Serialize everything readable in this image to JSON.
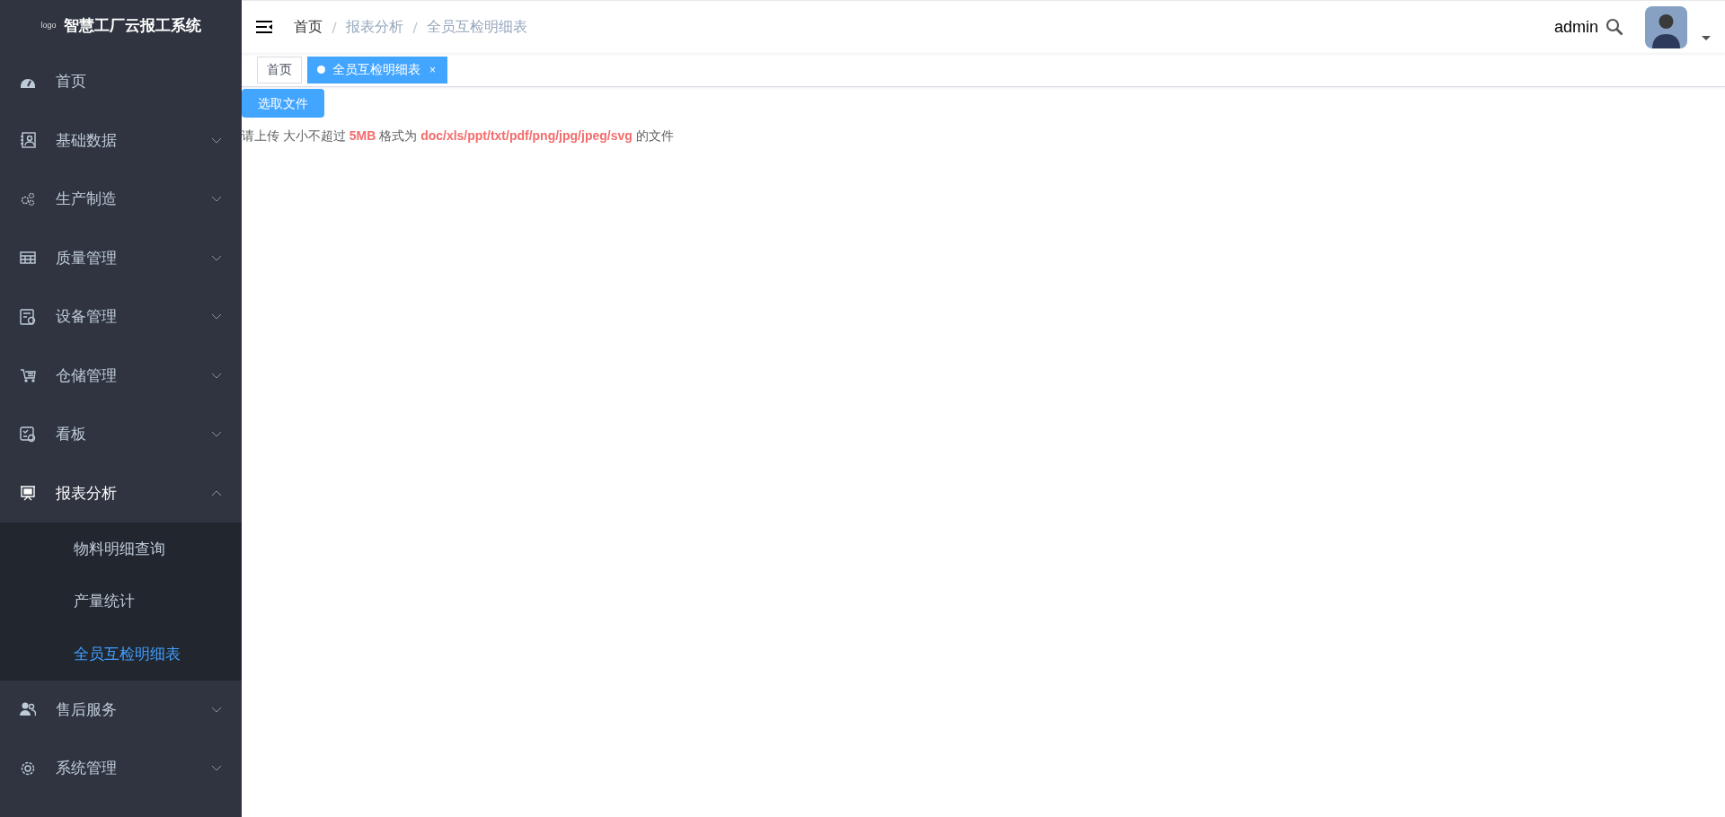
{
  "sidebar": {
    "logo_text": "logo",
    "title": "智慧工厂云报工系统",
    "items": [
      {
        "label": "首页",
        "kind": "link"
      },
      {
        "label": "基础数据",
        "kind": "group",
        "expanded": false
      },
      {
        "label": "生产制造",
        "kind": "group",
        "expanded": false
      },
      {
        "label": "质量管理",
        "kind": "group",
        "expanded": false
      },
      {
        "label": "设备管理",
        "kind": "group",
        "expanded": false
      },
      {
        "label": "仓储管理",
        "kind": "group",
        "expanded": false
      },
      {
        "label": "看板",
        "kind": "group",
        "expanded": false
      },
      {
        "label": "报表分析",
        "kind": "group",
        "expanded": true,
        "children": [
          {
            "label": "物料明细查询",
            "selected": false
          },
          {
            "label": "产量统计",
            "selected": false
          },
          {
            "label": "全员互检明细表",
            "selected": true
          }
        ]
      },
      {
        "label": "售后服务",
        "kind": "group",
        "expanded": false
      },
      {
        "label": "系统管理",
        "kind": "group",
        "expanded": false
      }
    ]
  },
  "breadcrumb": [
    "首页",
    "报表分析",
    "全员互检明细表"
  ],
  "user": {
    "name": "admin"
  },
  "tabs": [
    {
      "label": "首页",
      "selected": false,
      "closable": false
    },
    {
      "label": "全员互检明细表",
      "selected": true,
      "closable": true
    }
  ],
  "tab_close_glyph": "×",
  "upload": {
    "button": "选取文件",
    "tip": "请上传 大小不超过 **5MB** 格式为 **doc/xls/ppt/txt/pdf/png/jpg/jpeg/svg** 的文件"
  }
}
